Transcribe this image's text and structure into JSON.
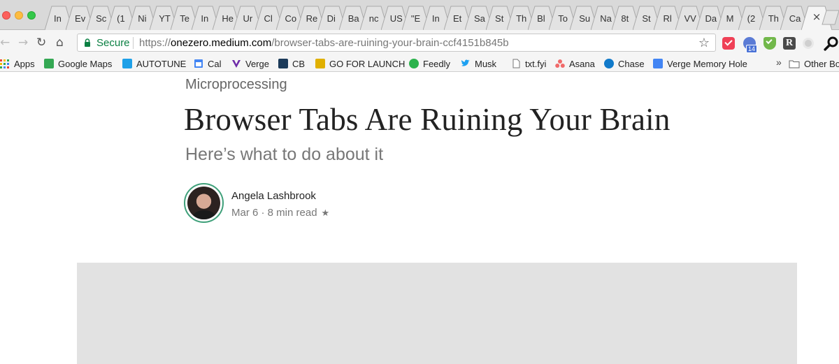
{
  "tabs": [
    "In",
    "Ev",
    "Sc",
    "(1",
    "Ni",
    "YT",
    "Te",
    "In",
    "He",
    "Ur",
    "Cl",
    "Co",
    "Re",
    "Di",
    "Ba",
    "nc",
    "US",
    "\"E",
    "In",
    "Et",
    "Sa",
    "St",
    "Th",
    "Bl",
    "To",
    "Su",
    "Na",
    "8t",
    "St",
    "Rl",
    "VV",
    "Da",
    "M",
    "(2",
    "Th",
    "Ca"
  ],
  "active_tab_close": "×",
  "toolbar": {
    "back": "←",
    "forward": "→",
    "reload": "↻",
    "home": "⌂",
    "secure_label": "Secure",
    "url_scheme": "https://",
    "url_host": "onezero.medium.com",
    "url_path": "/browser-tabs-are-ruining-your-brain-ccf4151b845b",
    "star": "☆"
  },
  "extensions": {
    "calendar_badge": "14",
    "readability_letter": "R"
  },
  "bookmarks": [
    {
      "label": "Apps",
      "icon": "apps-grid-icon",
      "color": "#4285f4"
    },
    {
      "label": "Google Maps",
      "icon": "maps-icon",
      "color": "#34a853"
    },
    {
      "label": "AUTOTUNE",
      "icon": "cube-icon",
      "color": "#1ea0e8"
    },
    {
      "label": "Cal",
      "icon": "calendar-icon",
      "color": "#4285f4"
    },
    {
      "label": "Verge",
      "icon": "verge-icon",
      "color": "#6d2aa8"
    },
    {
      "label": "CB",
      "icon": "cb-icon",
      "color": "#1c3b5a"
    },
    {
      "label": "GO FOR LAUNCH",
      "icon": "rocket-icon",
      "color": "#e0b000"
    },
    {
      "label": "Feedly",
      "icon": "feedly-icon",
      "color": "#2bb24c"
    },
    {
      "label": "Musk",
      "icon": "twitter-icon",
      "color": "#1da1f2"
    },
    {
      "label": "txt.fyi",
      "icon": "document-icon",
      "color": "#888888"
    },
    {
      "label": "Asana",
      "icon": "asana-icon",
      "color": "#f06a6a"
    },
    {
      "label": "Chase",
      "icon": "chase-icon",
      "color": "#117aca"
    },
    {
      "label": "Verge Memory Hole",
      "icon": "docs-icon",
      "color": "#4285f4"
    },
    {
      "label": "Other Bo",
      "icon": "folder-icon",
      "color": "#888888"
    }
  ],
  "bookmarks_overflow": "»",
  "article": {
    "kicker": "Microprocessing",
    "title": "Browser Tabs Are Ruining Your Brain",
    "subtitle": "Here’s what to do about it",
    "author": "Angela Lashbrook",
    "meta": "Mar 6 · 8 min read",
    "meta_star": "★"
  }
}
